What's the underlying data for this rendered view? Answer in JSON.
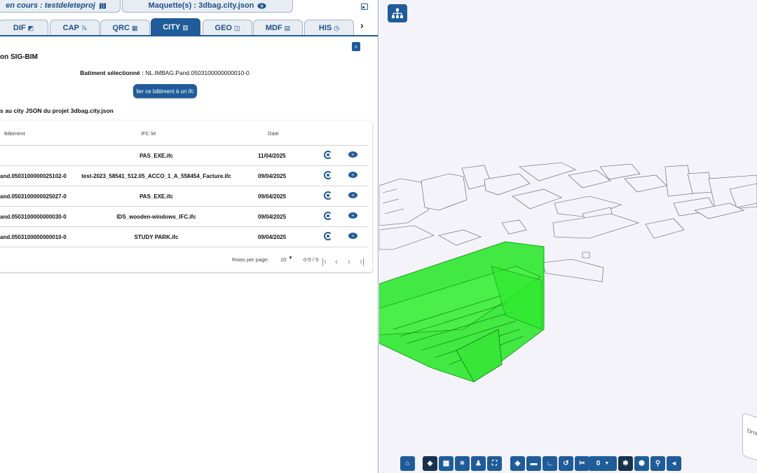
{
  "header": {
    "project_label": "en cours : testdeleteproj",
    "project_icon": "map-icon",
    "maquette_label": "Maquette(s) : 3dbag.city.json",
    "maquette_icon": "eye-icon"
  },
  "tabs": [
    {
      "label": "DIF",
      "icon": "◩",
      "active": false
    },
    {
      "label": "CAP",
      "icon": "⅞",
      "active": false
    },
    {
      "label": "QRC",
      "icon": "▦",
      "active": false
    },
    {
      "label": "CITY",
      "icon": "▥",
      "active": true
    },
    {
      "label": "GEO",
      "icon": "◫",
      "active": false
    },
    {
      "label": "MDF",
      "icon": "▤",
      "active": false
    },
    {
      "label": "HIS",
      "icon": "◷",
      "active": false
    }
  ],
  "tabs_next": "›",
  "panel": {
    "title": "on SIG-BIM",
    "selected_label": "Batiment sélectionné :",
    "selected_value": "NL.IMBAG.Pand.0503100000000010-0",
    "link_button": "lier ce bâtiment à un ifc",
    "links_title": "s au city JSON du projet 3dbag.city.json"
  },
  "table": {
    "headers": {
      "batiment": "Bâtiment",
      "ifc": "IFC lié",
      "date": "Date"
    },
    "rows": [
      {
        "batiment": "",
        "ifc": "PAS_EXE.ifc",
        "date": "11/04/2025"
      },
      {
        "batiment": "and.0503100000025102-0",
        "ifc": "test-2023_58541_512.05_ACCO_1_A_558454_Facture.ifc",
        "date": "09/04/2025"
      },
      {
        "batiment": "and.0503100000025027-0",
        "ifc": "PAS_EXE.ifc",
        "date": "09/04/2025"
      },
      {
        "batiment": "and.0503100000000030-0",
        "ifc": "IDS_wooden-windows_IFC.ifc",
        "date": "09/04/2025"
      },
      {
        "batiment": "and.0503100000000010-0",
        "ifc": "STUDY PARK.ifc",
        "date": "09/04/2025"
      }
    ],
    "pager": {
      "rows_per_page_label": "Rows per page:",
      "rows_per_page_value": "10",
      "range": "0-5 / 5"
    }
  },
  "viewer": {
    "cube_label": "Droite",
    "clip_value": "0",
    "highlight_color": "#22e622",
    "toolbar_icons": [
      "home-icon",
      "cube-icon",
      "grid-icon",
      "crop-icon",
      "person-icon",
      "frame-icon",
      "eraser-icon",
      "ruler-icon",
      "angle-icon",
      "undo-icon",
      "scissors-icon",
      "settings-icon",
      "box-icon",
      "pin-icon",
      "collapse-icon"
    ]
  }
}
